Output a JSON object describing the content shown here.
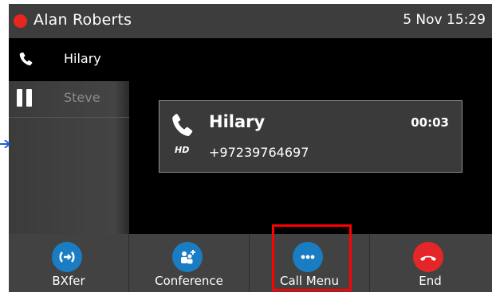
{
  "header": {
    "owner_name": "Alan Roberts",
    "datetime": "5 Nov 15:29",
    "status_color": "#e8261e"
  },
  "lines": [
    {
      "name": "Hilary",
      "state": "active",
      "icon": "phone-icon"
    },
    {
      "name": "Steve",
      "state": "held",
      "icon": "pause-icon"
    }
  ],
  "active_call": {
    "caller_name": "Hilary",
    "duration": "00:03",
    "number": "+97239764697",
    "quality_badge": "HD"
  },
  "softkeys": [
    {
      "label": "BXfer",
      "icon": "blind-transfer-icon",
      "color": "#1a7dc4"
    },
    {
      "label": "Conference",
      "icon": "conference-icon",
      "color": "#1a7dc4"
    },
    {
      "label": "Call Menu",
      "icon": "more-dots-icon",
      "color": "#1a7dc4",
      "highlighted": true
    },
    {
      "label": "End",
      "icon": "hang-up-icon",
      "color": "#e52629"
    }
  ]
}
